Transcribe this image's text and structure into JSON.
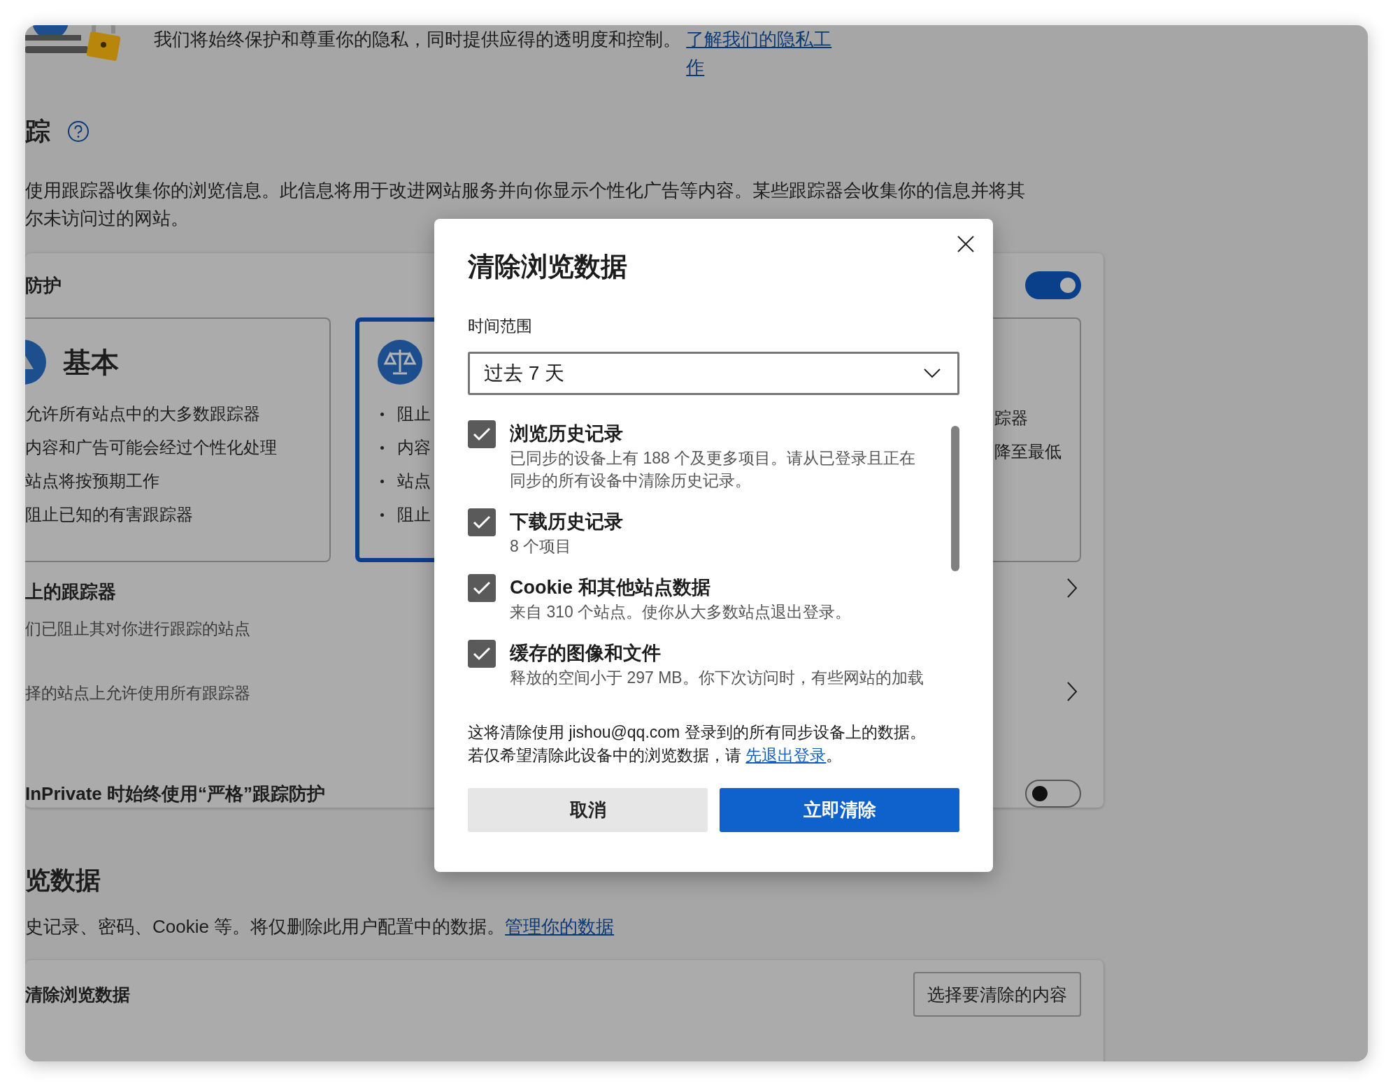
{
  "privacy_intro": {
    "text": "我们将始终保护和尊重你的隐私，同时提供应得的透明度和控制。",
    "link": "了解我们的隐私工作"
  },
  "tracking": {
    "heading": "踪",
    "description": "使用跟踪器收集你的浏览信息。此信息将用于改进网站服务并向你显示个性化广告等内容。某些跟踪器会收集你的信息并将其",
    "description_line2": "尔未访问过的网站。",
    "protection": {
      "title": "防护",
      "on": true,
      "levels": [
        {
          "kind": "basic",
          "title": "基本",
          "selected": false,
          "points": [
            "允许所有站点中的大多数跟踪器",
            "内容和广告可能会经过个性化处理",
            "站点将按预期工作",
            "阻止已知的有害跟踪器"
          ]
        },
        {
          "kind": "balanced",
          "selected": true,
          "points": [
            "阻止",
            "内容",
            "站点",
            "阻止"
          ]
        },
        {
          "kind": "strict",
          "selected": false,
          "points": [
            "踪器",
            "降至最低"
          ]
        }
      ],
      "rows": [
        {
          "title": "上的跟踪器",
          "subtitle": "们已阻止其对你进行跟踪的站点"
        },
        {
          "subtitle": "择的站点上允许使用所有跟踪器"
        }
      ],
      "inprivate": {
        "label": "InPrivate 时始终使用“严格”跟踪防护",
        "on": false
      }
    }
  },
  "browsing_data": {
    "heading": "览数据",
    "description": "史记录、密码、Cookie 等。将仅删除此用户配置中的数据。",
    "link": "管理你的数据",
    "row_label": "清除浏览数据",
    "row_button": "选择要清除的内容"
  },
  "dialog": {
    "title": "清除浏览数据",
    "time_range_label": "时间范围",
    "time_range_value": "过去 7 天",
    "items": [
      {
        "title": "浏览历史记录",
        "description": "已同步的设备上有 188 个及更多项目。请从已登录且正在同步的所有设备中清除历史记录。",
        "checked": true
      },
      {
        "title": "下载历史记录",
        "description": "8 个项目",
        "checked": true
      },
      {
        "title": "Cookie 和其他站点数据",
        "description": "来自 310 个站点。使你从大多数站点退出登录。",
        "checked": true
      },
      {
        "title": "缓存的图像和文件",
        "description": "释放的空间小于 297 MB。你下次访问时，有些网站的加载",
        "checked": true
      }
    ],
    "note_line1": "这将清除使用 jishou@qq.com 登录到的所有同步设备上的数据。",
    "note_line2": "若仅希望清除此设备中的浏览数据，请 ",
    "note_link": "先退出登录",
    "note_end": "。",
    "cancel": "取消",
    "confirm": "立即清除"
  }
}
